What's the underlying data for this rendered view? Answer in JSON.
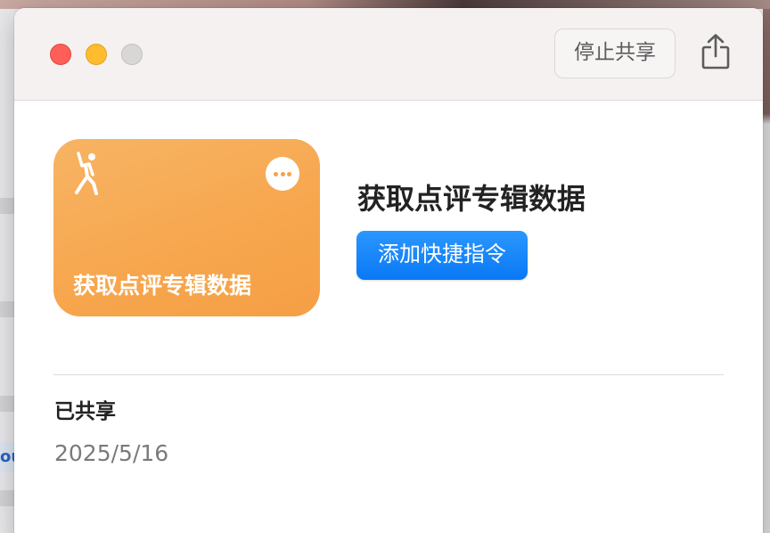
{
  "window": {
    "stop_share_label": "停止共享",
    "share_icon": "share-icon"
  },
  "shortcut": {
    "card_icon": "person-dancing-icon",
    "card_color": "#f7a64d",
    "card_title": "获取点评专辑数据",
    "title": "获取点评专辑数据",
    "add_button_label": "添加快捷指令",
    "add_button_color": "#0a84ff"
  },
  "details": {
    "shared_label": "已共享",
    "shared_date": "2025/5/16"
  },
  "background": {
    "partial_text": "ou"
  }
}
